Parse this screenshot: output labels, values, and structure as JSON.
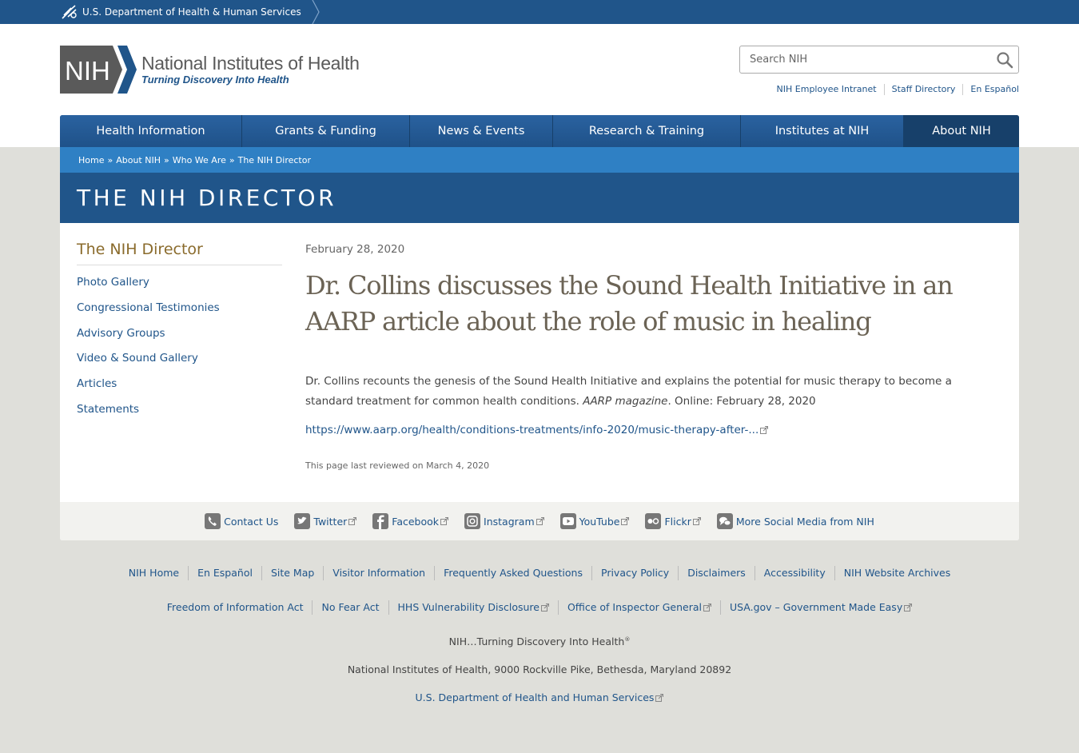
{
  "hhs": {
    "label": "U.S. Department of Health & Human Services"
  },
  "logo": {
    "mark_text": "NIH",
    "title": "National Institutes of Health",
    "tagline": "Turning Discovery Into Health"
  },
  "search": {
    "placeholder": "Search NIH",
    "value": ""
  },
  "util_links": [
    "NIH Employee Intranet",
    "Staff Directory",
    "En Español"
  ],
  "nav": [
    {
      "label": "Health Information",
      "active": false
    },
    {
      "label": "Grants & Funding",
      "active": false
    },
    {
      "label": "News & Events",
      "active": false
    },
    {
      "label": "Research & Training",
      "active": false
    },
    {
      "label": "Institutes at NIH",
      "active": false
    },
    {
      "label": "About NIH",
      "active": true
    }
  ],
  "breadcrumb": [
    "Home",
    "About NIH",
    "Who We Are",
    "The NIH Director"
  ],
  "breadcrumb_separator": "»",
  "page_title": "THE NIH DIRECTOR",
  "sidebar": {
    "title": "The NIH Director",
    "items": [
      "Photo Gallery",
      "Congressional Testimonies",
      "Advisory Groups",
      "Video & Sound Gallery",
      "Articles",
      "Statements"
    ]
  },
  "article": {
    "date": "February 28, 2020",
    "headline": "Dr. Collins discusses the Sound Health Initiative in an AARP article about the role of music in healing",
    "body_intro": "Dr. Collins recounts the genesis of the Sound Health Initiative and explains the potential for music therapy to become a standard treatment for common health conditions. ",
    "body_source": "AARP magazine",
    "body_outro": ". Online: February 28, 2020",
    "link": "https://www.aarp.org/health/conditions-treatments/info-2020/music-therapy-after-...",
    "reviewed": "This page last reviewed on March 4, 2020"
  },
  "social": [
    {
      "label": "Contact Us",
      "icon": "phone-icon",
      "external": false
    },
    {
      "label": "Twitter",
      "icon": "twitter-icon",
      "external": true
    },
    {
      "label": "Facebook",
      "icon": "facebook-icon",
      "external": true
    },
    {
      "label": "Instagram",
      "icon": "instagram-icon",
      "external": true
    },
    {
      "label": "YouTube",
      "icon": "youtube-icon",
      "external": true
    },
    {
      "label": "Flickr",
      "icon": "flickr-icon",
      "external": true
    },
    {
      "label": "More Social Media from NIH",
      "icon": "social-media-icon",
      "external": false
    }
  ],
  "footer": {
    "row1": [
      "NIH Home",
      "En Español",
      "Site Map",
      "Visitor Information",
      "Frequently Asked Questions",
      "Privacy Policy",
      "Disclaimers",
      "Accessibility",
      "NIH Website Archives"
    ],
    "row2": [
      "Freedom of Information Act",
      "No Fear Act",
      "HHS Vulnerability Disclosure",
      "Office of Inspector General",
      "USA.gov – Government Made Easy"
    ],
    "tagline": "NIH…Turning Discovery Into Health",
    "tagline_mark": "®",
    "address": "National Institutes of Health, 9000 Rockville Pike, Bethesda, Maryland 20892",
    "hhs_link": "U.S. Department of Health and Human Services"
  },
  "colors": {
    "primary": "#20558a",
    "breadcrumb": "#2f80c4",
    "nav_active": "#17406a",
    "sidebar_title": "#8a6b2c",
    "page_bg": "#dfdfda"
  }
}
